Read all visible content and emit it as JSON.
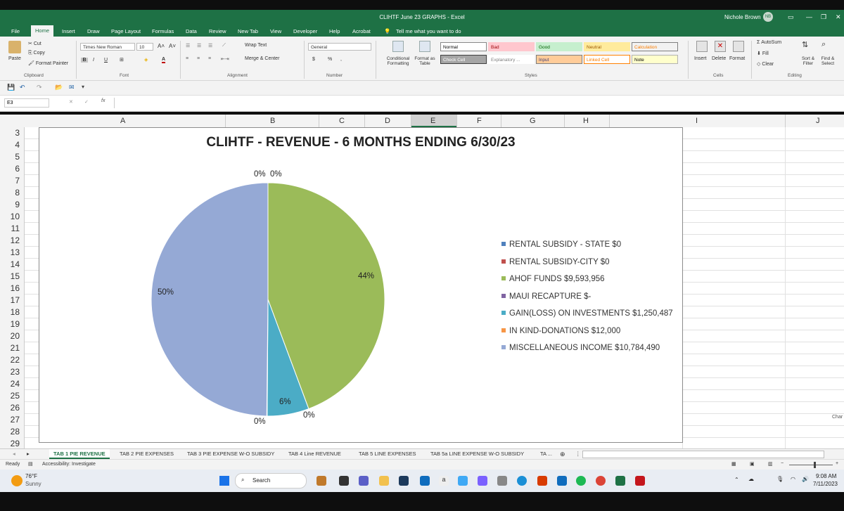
{
  "window": {
    "title": "CLIHTF June 23 GRAPHS - Excel",
    "user": "Nichole Brown",
    "user_initials": "NB"
  },
  "menu": {
    "tabs": [
      "File",
      "Home",
      "Insert",
      "Draw",
      "Page Layout",
      "Formulas",
      "Data",
      "Review",
      "New Tab",
      "View",
      "Developer",
      "Help",
      "Acrobat"
    ],
    "active": "Home",
    "tell_me": "Tell me what you want to do"
  },
  "ribbon": {
    "clipboard": {
      "paste": "Paste",
      "cut": "Cut",
      "copy": "Copy",
      "format_painter": "Format Painter",
      "label": "Clipboard"
    },
    "font": {
      "name": "Times New Roman",
      "size": "10",
      "bold": "B",
      "italic": "I",
      "underline": "U",
      "label": "Font"
    },
    "alignment": {
      "wrap_text": "Wrap Text",
      "merge_center": "Merge & Center",
      "label": "Alignment"
    },
    "number": {
      "format": "General",
      "currency": "$",
      "percent": "%",
      "comma": ",",
      "label": "Number"
    },
    "styles": {
      "conditional_formatting": "Conditional Formatting",
      "format_as_table": "Format as Table",
      "cells": [
        {
          "label": "Normal",
          "bg": "#ffffff",
          "fg": "#000000",
          "border": "#888888"
        },
        {
          "label": "Bad",
          "bg": "#ffc7ce",
          "fg": "#9c0006",
          "border": "#ffc7ce"
        },
        {
          "label": "Good",
          "bg": "#c6efce",
          "fg": "#006100",
          "border": "#c6efce"
        },
        {
          "label": "Neutral",
          "bg": "#ffeb9c",
          "fg": "#9c5700",
          "border": "#ffeb9c"
        },
        {
          "label": "Calculation",
          "bg": "#f2f2f2",
          "fg": "#fa7d00",
          "border": "#7f7f7f"
        },
        {
          "label": "Check Cell",
          "bg": "#a5a5a5",
          "fg": "#ffffff",
          "border": "#3f3f3f"
        },
        {
          "label": "Explanatory ...",
          "bg": "#ffffff",
          "fg": "#7f7f7f",
          "border": "#ffffff"
        },
        {
          "label": "Input",
          "bg": "#ffcc99",
          "fg": "#3f3f76",
          "border": "#7f7f7f"
        },
        {
          "label": "Linked Cell",
          "bg": "#ffffff",
          "fg": "#fa7d00",
          "border": "#ff8001"
        },
        {
          "label": "Note",
          "bg": "#ffffcc",
          "fg": "#000000",
          "border": "#b2b2b2"
        }
      ],
      "label": "Styles"
    },
    "cells": {
      "insert": "Insert",
      "delete": "Delete",
      "format": "Format",
      "label": "Cells"
    },
    "editing": {
      "autosum": "AutoSum",
      "fill": "Fill",
      "clear": "Clear",
      "sort_filter": "Sort & Filter",
      "find_select": "Find & Select",
      "label": "Editing"
    }
  },
  "formula_bar": {
    "name_box": "E3",
    "fx": "fx",
    "value": ""
  },
  "columns": [
    "A",
    "B",
    "C",
    "D",
    "E",
    "F",
    "G",
    "H",
    "I",
    "J"
  ],
  "rows": [
    "3",
    "4",
    "5",
    "6",
    "7",
    "8",
    "9",
    "10",
    "11",
    "12",
    "13",
    "14",
    "15",
    "16",
    "17",
    "18",
    "19",
    "20",
    "21",
    "22",
    "23",
    "24",
    "25",
    "26",
    "27",
    "28",
    "29"
  ],
  "chart_data": {
    "type": "pie",
    "title": "CLIHTF - REVENUE - 6 MONTHS ENDING 6/30/23",
    "legend_position": "right",
    "slices": [
      {
        "label": "RENTAL SUBSIDY - STATE $0",
        "value": 0,
        "percent": "0%",
        "color": "#4f81bd"
      },
      {
        "label": "RENTAL SUBSIDY-CITY $0",
        "value": 0,
        "percent": "0%",
        "color": "#c0504d"
      },
      {
        "label": "AHOF FUNDS  $9,593,956",
        "value": 9593956,
        "percent": "44%",
        "color": "#9bbb59"
      },
      {
        "label": "MAUI RECAPTURE  $-",
        "value": 0,
        "percent": "0%",
        "color": "#8064a2"
      },
      {
        "label": "GAIN(LOSS) ON INVESTMENTS $1,250,487",
        "value": 1250487,
        "percent": "6%",
        "color": "#4bacc6"
      },
      {
        "label": "IN KIND-DONATIONS $12,000",
        "value": 12000,
        "percent": "0%",
        "color": "#f79646"
      },
      {
        "label": "MISCELLANEOUS INCOME  $10,784,490",
        "value": 10784490,
        "percent": "50%",
        "color": "#95a9d5"
      }
    ]
  },
  "sheet_tabs": [
    "TAB 1 PIE REVENUE",
    "TAB 2 PIE EXPENSES",
    "TAB 3 PIE EXPENSE W-O SUBSIDY",
    "TAB 4 Line REVENUE",
    "TAB 5 LINE EXPENSES",
    "TAB 5a LINE EXPENSE W-O SUBSIDY",
    "TA ..."
  ],
  "active_sheet": "TAB 1 PIE REVENUE",
  "status": {
    "ready": "Ready",
    "accessibility": "Accessibility: Investigate",
    "chart_tooltip": "Char"
  },
  "taskbar": {
    "temp": "76°F",
    "weather": "Sunny",
    "search": "Search",
    "time": "9:08 AM",
    "date": "7/11/2023"
  }
}
